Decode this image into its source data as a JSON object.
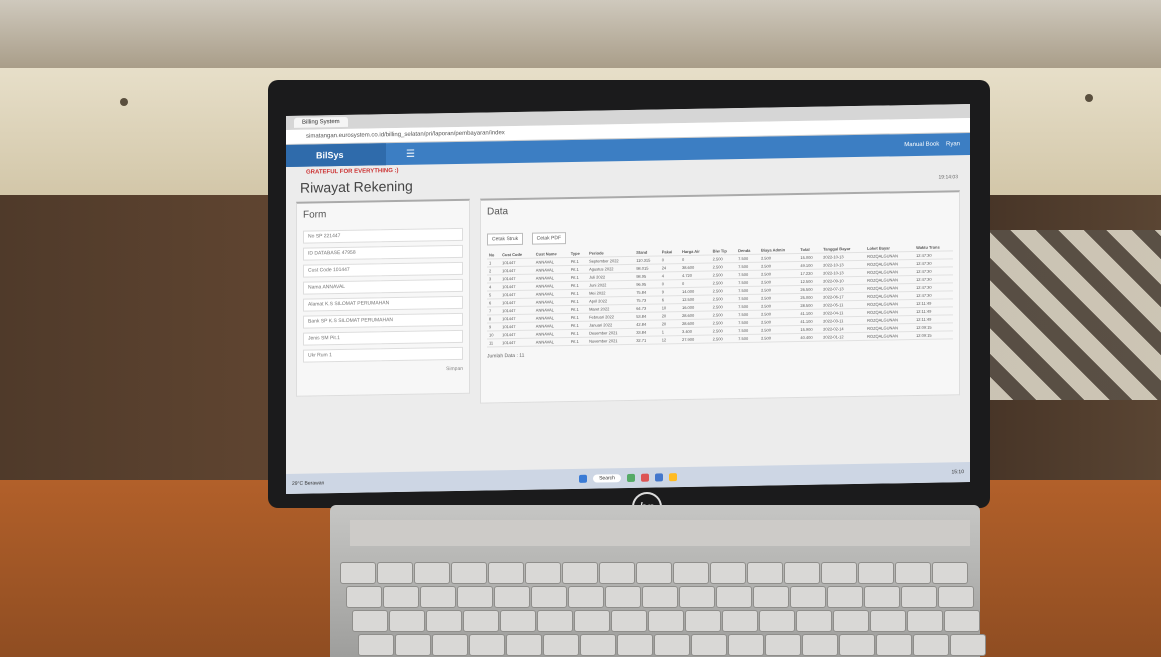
{
  "browser": {
    "tab_title": "Billing System",
    "url": "simatangan.eurosystem.co.id/billing_selatan/pri/laporan/pembayaran/index"
  },
  "app": {
    "brand": "BilSys",
    "menu_right": "Manual Book",
    "user": "Ryan",
    "slogan": "GRATEFUL FOR EVERYTHING :)",
    "page_title": "Riwayat Rekening",
    "timestamp": "19:14:03"
  },
  "form": {
    "title": "Form",
    "fields": [
      {
        "label": "No SP",
        "value": "221447"
      },
      {
        "label": "ID DATABASE",
        "value": "47958"
      },
      {
        "label": "Cust Code",
        "value": "101447"
      },
      {
        "label": "Nama",
        "value": "ANNAVAL"
      },
      {
        "label": "Alamat",
        "value": "K.S SILOMAT PERUMAHAN"
      },
      {
        "label": "Bank SP",
        "value": "K.S SILOMAT PERUMAHAN"
      },
      {
        "label": "Jenis SM",
        "value": "Pit.1"
      },
      {
        "label": "Ukr Rum",
        "value": "1"
      }
    ],
    "footer": "Simpan"
  },
  "data": {
    "title": "Data",
    "buttons": [
      "Cetak Struk",
      "Cetak PDF"
    ],
    "columns": [
      "No",
      "Cust Code",
      "Cust Name",
      "Type",
      "Periode",
      "Stand",
      "Pakai",
      "Harga Air",
      "Biw Tip",
      "Denda",
      "Biaya Admin",
      "Total",
      "Tanggal Bayar",
      "Loket Bayar",
      "Waktu Trans"
    ],
    "rows": [
      [
        "1",
        "101447",
        "ANNAVAL",
        "Pit.1",
        "September 2022",
        "110.315",
        "0",
        "0",
        "2.500",
        "7.500",
        "2.500",
        "15.000",
        "2022-10-13",
        "ROZQALGUNAN",
        "12:47:30"
      ],
      [
        "2",
        "101447",
        "ANNAVAL",
        "Pit.1",
        "Agustus 2022",
        "98.015",
        "24",
        "38.600",
        "2.500",
        "7.500",
        "2.500",
        "49.100",
        "2022-10-13",
        "ROZQALGUNAN",
        "12:47:30"
      ],
      [
        "3",
        "101447",
        "ANNAVAL",
        "Pit.1",
        "Juli 2022",
        "98.95",
        "4",
        "4.720",
        "2.500",
        "7.500",
        "2.500",
        "17.220",
        "2022-10-13",
        "ROZQALGUNAN",
        "12:47:30"
      ],
      [
        "4",
        "101447",
        "ANNAVAL",
        "Pit.1",
        "Juni 2022",
        "96.95",
        "0",
        "0",
        "2.500",
        "7.500",
        "2.500",
        "12.500",
        "2022-09-10",
        "ROZQALGUNAN",
        "12:47:30"
      ],
      [
        "5",
        "101447",
        "ANNAVAL",
        "Pit.1",
        "Mei 2022",
        "75.84",
        "9",
        "14.000",
        "2.500",
        "7.500",
        "2.500",
        "26.500",
        "2022-07-13",
        "ROZQALGUNAN",
        "12:47:30"
      ],
      [
        "6",
        "101447",
        "ANNAVAL",
        "Pit.1",
        "April 2022",
        "75.73",
        "6",
        "12.500",
        "2.500",
        "7.500",
        "2.500",
        "25.000",
        "2022-06-17",
        "ROZQALGUNAN",
        "12:47:30"
      ],
      [
        "7",
        "101447",
        "ANNAVAL",
        "Pit.1",
        "Maret 2022",
        "64.73",
        "10",
        "16.000",
        "2.500",
        "7.500",
        "2.500",
        "28.500",
        "2022-05-11",
        "ROZQALGUNAN",
        "12:11:49"
      ],
      [
        "8",
        "101447",
        "ANNAVAL",
        "Pit.1",
        "Februari 2022",
        "53.84",
        "20",
        "28.600",
        "2.500",
        "7.500",
        "2.500",
        "41.100",
        "2022-04-11",
        "ROZQALGUNAN",
        "12:11:49"
      ],
      [
        "9",
        "101447",
        "ANNAVAL",
        "Pit.1",
        "Januari 2022",
        "42.84",
        "20",
        "28.600",
        "2.500",
        "7.500",
        "2.500",
        "41.100",
        "2022-03-11",
        "ROZQALGUNAN",
        "12:11:49"
      ],
      [
        "10",
        "101447",
        "ANNAVAL",
        "Pit.1",
        "Desember 2021",
        "33.84",
        "1",
        "3.400",
        "2.500",
        "7.500",
        "2.500",
        "15.900",
        "2022-02-14",
        "ROZQALGUNAN",
        "12:09:15"
      ],
      [
        "11",
        "101447",
        "ANNAVAL",
        "Pit.1",
        "November 2021",
        "32.71",
        "12",
        "27.900",
        "2.500",
        "7.500",
        "2.500",
        "40.400",
        "2022-01-12",
        "ROZQALGUNAN",
        "12:09:15"
      ]
    ],
    "footer": "Jumlah Data : 11"
  },
  "taskbar": {
    "weather": "29°C Berawan",
    "search": "Search",
    "clock": "15:10"
  },
  "colors": {
    "appbar": "#3c7ec3",
    "brand_bg": "#2f6bab",
    "slogan": "#cc3333"
  }
}
